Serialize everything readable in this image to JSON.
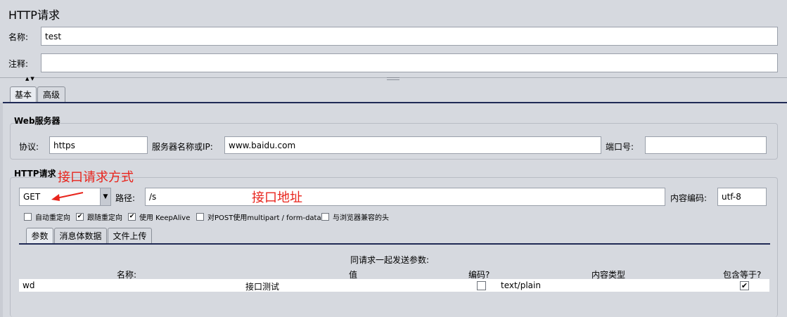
{
  "window": {
    "title": "HTTP请求"
  },
  "form": {
    "name_label": "名称:",
    "name_value": "test",
    "comment_label": "注释:",
    "comment_value": ""
  },
  "splitter": {
    "arrows": "▲▼"
  },
  "tabs": [
    {
      "label": "基本",
      "active": true
    },
    {
      "label": "高级",
      "active": false
    }
  ],
  "web_server": {
    "section_title": "Web服务器",
    "protocol_label": "协议:",
    "protocol_value": "https",
    "server_label": "服务器名称或IP:",
    "server_value": "www.baidu.com",
    "port_label": "端口号:",
    "port_value": ""
  },
  "http_request": {
    "section_title": "HTTP请求",
    "method_value": "GET",
    "path_label": "路径:",
    "path_value": "/s",
    "encoding_label": "内容编码:",
    "encoding_value": "utf-8",
    "checkboxes": [
      {
        "label": "自动重定向",
        "checked": false
      },
      {
        "label": "跟随重定向",
        "checked": true
      },
      {
        "label": "使用 KeepAlive",
        "checked": true
      },
      {
        "label": "对POST使用multipart / form-data",
        "checked": false
      },
      {
        "label": "与浏览器兼容的头",
        "checked": false
      }
    ]
  },
  "annotations": {
    "method_note": "接口请求方式",
    "path_note": "接口地址"
  },
  "sub_tabs": [
    {
      "label": "参数",
      "active": true
    },
    {
      "label": "消息体数据",
      "active": false
    },
    {
      "label": "文件上传",
      "active": false
    }
  ],
  "params": {
    "caption": "同请求一起发送参数:",
    "headers": {
      "name": "名称:",
      "value": "值",
      "encode": "编码?",
      "content_type": "内容类型",
      "include_equals": "包含等于?"
    },
    "rows": [
      {
        "name": "wd",
        "value": "接口测试",
        "encode": false,
        "content_type": "text/plain",
        "include_equals": true
      }
    ]
  },
  "colors": {
    "annotation": "#e8241c",
    "tab_rule": "#202a55"
  }
}
